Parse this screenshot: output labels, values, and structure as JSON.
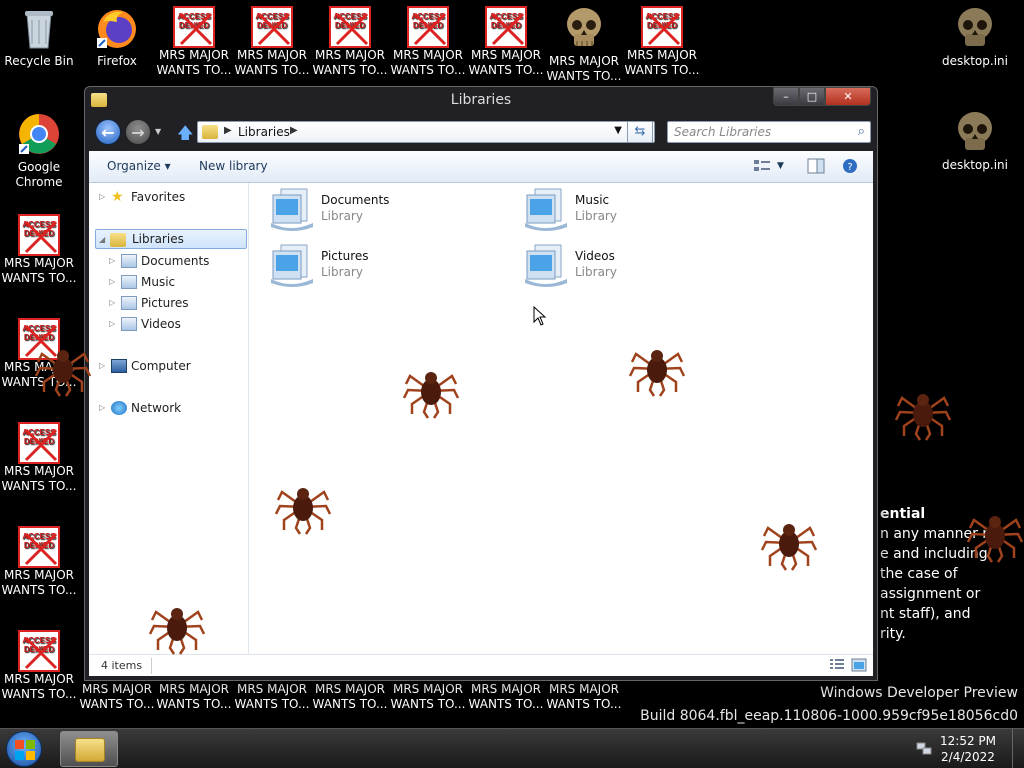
{
  "desktop": {
    "recycle_bin": "Recycle Bin",
    "firefox": "Firefox",
    "chrome": "Google Chrome",
    "desktop_ini": "desktop.ini",
    "mrs_major": "MRS MAJOR\nWANTS TO...",
    "access_denied": "ACCESS\nDENIED"
  },
  "wallpaper": {
    "heading_fragment": "ential",
    "lines": [
      "n any manner n",
      "e and including",
      "the case of",
      "assignment or",
      "nt staff), and",
      "rity."
    ]
  },
  "watermark": {
    "line1": "Windows Developer Preview",
    "line2": "Build 8064.fbl_eeap.110806-1000.959cf95e18056cd0"
  },
  "window": {
    "title": "Libraries",
    "address_crumb": "Libraries",
    "search_placeholder": "Search Libraries",
    "toolbar": {
      "organize": "Organize ▾",
      "new_library": "New library"
    },
    "nav": {
      "favorites": "Favorites",
      "libraries": "Libraries",
      "documents": "Documents",
      "music": "Music",
      "pictures": "Pictures",
      "videos": "Videos",
      "computer": "Computer",
      "network": "Network"
    },
    "libraries": [
      {
        "name": "Documents",
        "type": "Library"
      },
      {
        "name": "Music",
        "type": "Library"
      },
      {
        "name": "Pictures",
        "type": "Library"
      },
      {
        "name": "Videos",
        "type": "Library"
      }
    ],
    "status": "4 items"
  },
  "taskbar": {
    "time": "12:52 PM",
    "date": "2/4/2022"
  }
}
